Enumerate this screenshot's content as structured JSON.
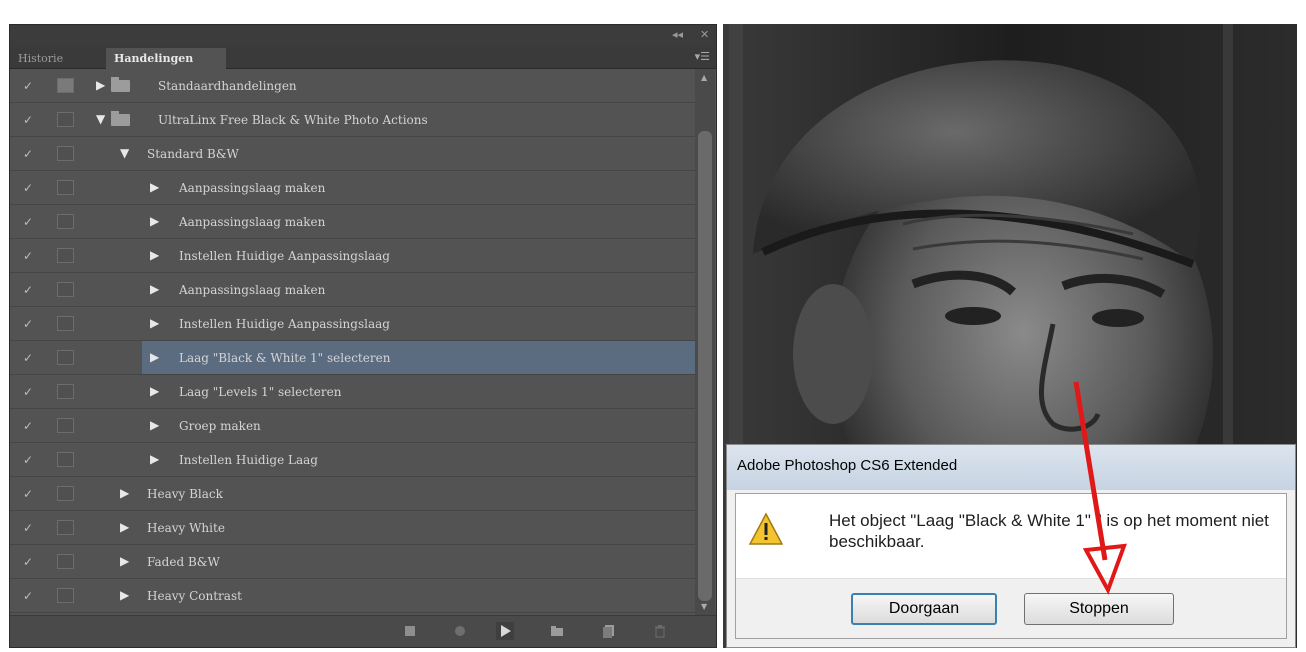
{
  "panel": {
    "tabs": [
      {
        "label": "Historie",
        "active": false
      },
      {
        "label": "Handelingen",
        "active": true
      }
    ],
    "top_controls": [
      "◂◂",
      "✕"
    ],
    "menu_icon": "panel-menu-icon",
    "rows": [
      {
        "label": "Standaardhandelingen",
        "level": "set",
        "expanded": false,
        "checked": true,
        "dialog_on": true,
        "selected": false
      },
      {
        "label": "UltraLinx Free Black & White Photo Actions",
        "level": "set",
        "expanded": true,
        "checked": true,
        "dialog_on": false,
        "selected": false
      },
      {
        "label": "Standard B&W",
        "level": "action",
        "expanded": true,
        "checked": true,
        "dialog_on": false,
        "selected": false
      },
      {
        "label": "Aanpassingslaag maken",
        "level": "step",
        "expanded": false,
        "checked": true,
        "dialog_on": false,
        "selected": false
      },
      {
        "label": "Aanpassingslaag maken",
        "level": "step",
        "expanded": false,
        "checked": true,
        "dialog_on": false,
        "selected": false
      },
      {
        "label": "Instellen  Huidige Aanpassingslaag",
        "level": "step",
        "expanded": false,
        "checked": true,
        "dialog_on": false,
        "selected": false
      },
      {
        "label": "Aanpassingslaag maken",
        "level": "step",
        "expanded": false,
        "checked": true,
        "dialog_on": false,
        "selected": false
      },
      {
        "label": "Instellen  Huidige Aanpassingslaag",
        "level": "step",
        "expanded": false,
        "checked": true,
        "dialog_on": false,
        "selected": false
      },
      {
        "label": "Laag \"Black & White 1\" selecteren",
        "level": "step",
        "expanded": false,
        "checked": true,
        "dialog_on": false,
        "selected": true
      },
      {
        "label": "Laag \"Levels 1\" selecteren",
        "level": "step",
        "expanded": false,
        "checked": true,
        "dialog_on": false,
        "selected": false
      },
      {
        "label": "Groep maken",
        "level": "step",
        "expanded": false,
        "checked": true,
        "dialog_on": false,
        "selected": false
      },
      {
        "label": "Instellen  Huidige Laag",
        "level": "step",
        "expanded": false,
        "checked": true,
        "dialog_on": false,
        "selected": false
      },
      {
        "label": "Heavy Black",
        "level": "action",
        "expanded": false,
        "checked": true,
        "dialog_on": false,
        "selected": false
      },
      {
        "label": "Heavy White",
        "level": "action",
        "expanded": false,
        "checked": true,
        "dialog_on": false,
        "selected": false
      },
      {
        "label": "Faded B&W",
        "level": "action",
        "expanded": false,
        "checked": true,
        "dialog_on": false,
        "selected": false
      },
      {
        "label": "Heavy Contrast",
        "level": "action",
        "expanded": false,
        "checked": true,
        "dialog_on": false,
        "selected": false
      }
    ],
    "bottom_icons": [
      "stop-icon",
      "record-icon",
      "play-icon",
      "new-set-icon",
      "new-action-icon",
      "delete-icon"
    ]
  },
  "dialog": {
    "title": "Adobe Photoshop CS6 Extended",
    "message": "Het object \"Laag \"Black & White 1\" \" is op het moment niet beschikbaar.",
    "icon": "warning-icon",
    "buttons": {
      "continue_label": "Doorgaan",
      "stop_label": "Stoppen"
    }
  },
  "annotation": {
    "arrow_color": "#e01818"
  },
  "colors": {
    "panel_bg": "#535353",
    "selected_row": "#5b6b80",
    "dialog_default_border": "#3c7fb1"
  }
}
